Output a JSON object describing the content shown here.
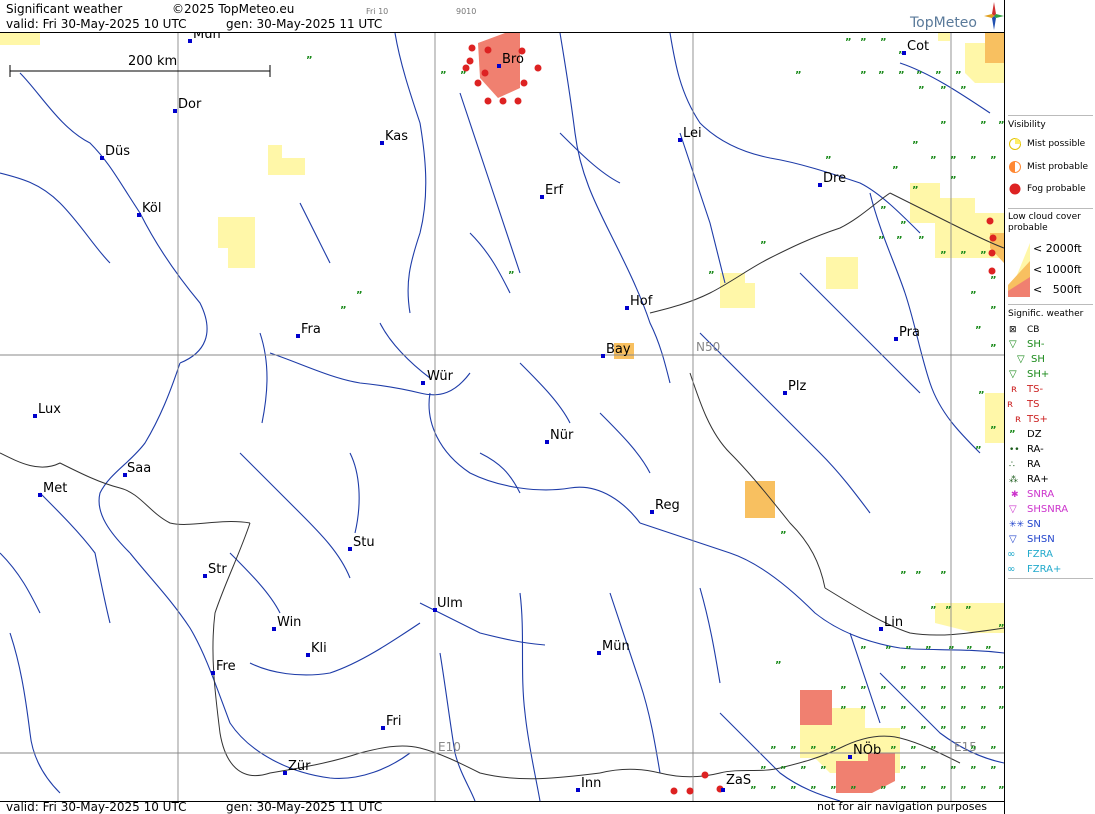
{
  "header": {
    "title": "Significant weather",
    "copyright": "©2025 TopMeteo.eu",
    "valid": "valid:  Fri  30-May-2025  10 UTC",
    "gen": "gen:  30-May-2025 11 UTC",
    "small_a": "Fri 10",
    "small_b": "9010",
    "logo": "TopMeteo"
  },
  "footer": {
    "valid": "valid:  Fri  30-May-2025  10 UTC",
    "gen": "gen:  30-May-2025 11 UTC",
    "disclaimer": "not for air navigation purposes"
  },
  "map": {
    "scale": "200 km",
    "grid_labels": {
      "n50": "N50",
      "e10": "E10",
      "e15": "E15"
    },
    "cities": [
      {
        "name": "Bro"
      },
      {
        "name": "Cot"
      },
      {
        "name": "Dor"
      },
      {
        "name": "Kas"
      },
      {
        "name": "Lei"
      },
      {
        "name": "Düs"
      },
      {
        "name": "Erf"
      },
      {
        "name": "Dre"
      },
      {
        "name": "Köl"
      },
      {
        "name": "Hof"
      },
      {
        "name": "Fra"
      },
      {
        "name": "Pra"
      },
      {
        "name": "Bay"
      },
      {
        "name": "Wür"
      },
      {
        "name": "Plz"
      },
      {
        "name": "Lux"
      },
      {
        "name": "Nür"
      },
      {
        "name": "Saa"
      },
      {
        "name": "Met"
      },
      {
        "name": "Reg"
      },
      {
        "name": "Stu"
      },
      {
        "name": "Str"
      },
      {
        "name": "Ulm"
      },
      {
        "name": "Win"
      },
      {
        "name": "Lin"
      },
      {
        "name": "Kli"
      },
      {
        "name": "Mün"
      },
      {
        "name": "Fre"
      },
      {
        "name": "Fri"
      },
      {
        "name": "NÖb"
      },
      {
        "name": "Zür"
      },
      {
        "name": "Inn"
      },
      {
        "name": "ZaS"
      },
      {
        "name": "Mün"
      }
    ]
  },
  "legend": {
    "visibility_title": "Visibility",
    "visibility": [
      "Mist possible",
      "Mist probable",
      "Fog probable"
    ],
    "lowcloud_title": "Low cloud cover probable",
    "lowcloud": [
      "< 2000ft",
      "< 1000ft",
      "<   500ft"
    ],
    "sigwx_title": "Signific. weather",
    "sigwx": [
      "CB",
      "SH-",
      "SH",
      "SH+",
      "TS-",
      "TS",
      "TS+",
      "DZ",
      "RA-",
      "RA",
      "RA+",
      "SNRA",
      "SHSNRA",
      "SN",
      "SHSN",
      "FZRA",
      "FZRA+"
    ],
    "colors": {
      "mist": "#ffee66",
      "mist_prob": "#ff8833",
      "fog": "#dd2222",
      "low2000": "#fff7a8",
      "low1000": "#f8c060",
      "low500": "#f08070",
      "river": "#1e3ca8",
      "drizzle": "#1a8a1a"
    }
  }
}
